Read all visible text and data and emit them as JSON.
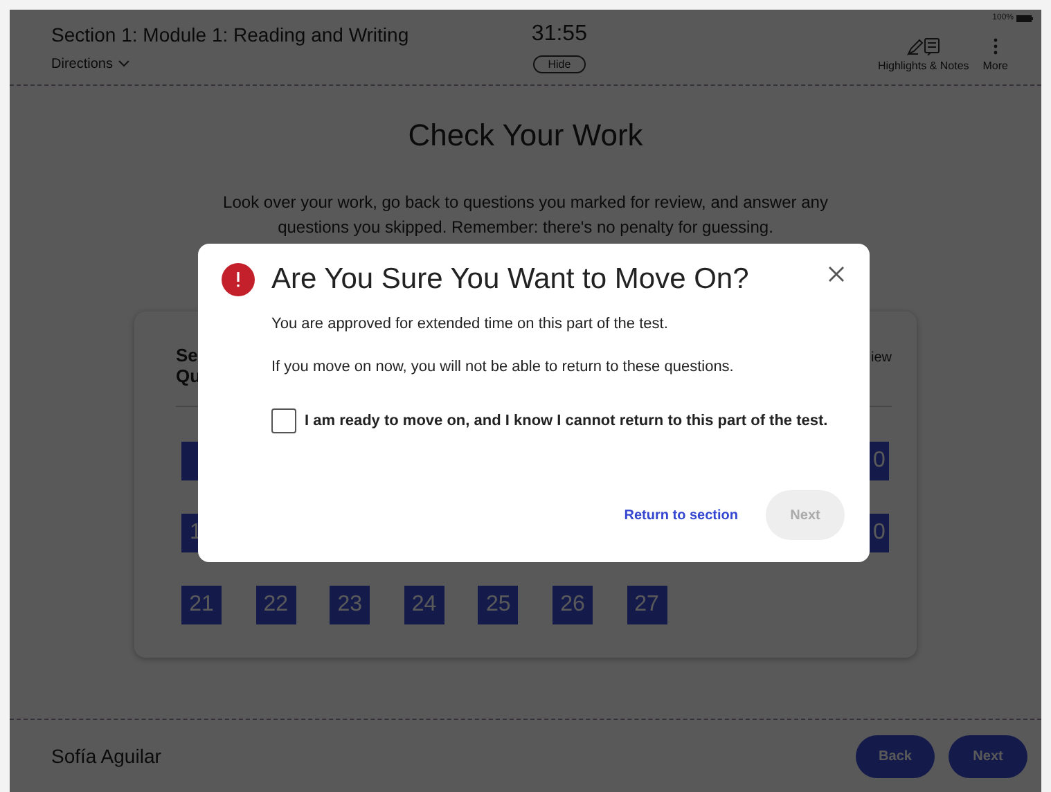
{
  "status": {
    "battery": "100%"
  },
  "header": {
    "title": "Section 1: Module 1: Reading and Writing",
    "directions": "Directions",
    "timer": "31:55",
    "hide_button": "Hide",
    "tools": [
      {
        "label": "Highlights & Notes",
        "kind": "highlights"
      },
      {
        "label": "More",
        "kind": "more"
      }
    ]
  },
  "page": {
    "title": "Check Your Work",
    "instructions": "Look over your work, go back to questions you marked for review, and answer any questions you skipped. Remember: there's no penalty for guessing.",
    "card": {
      "heading_lines": [
        "Se",
        "Qu"
      ],
      "legend": "iew",
      "rows": [
        {
          "cells": [
            {
              "label": "0",
              "kind": "last"
            }
          ]
        },
        {
          "cells": [
            {
              "label": "1",
              "kind": "first"
            },
            {
              "label": "0",
              "kind": "last"
            }
          ]
        },
        {
          "cells": [
            {
              "label": "21",
              "kind": "full"
            },
            {
              "label": "22",
              "kind": "full"
            },
            {
              "label": "23",
              "kind": "full"
            },
            {
              "label": "24",
              "kind": "full"
            },
            {
              "label": "25",
              "kind": "full"
            },
            {
              "label": "26",
              "kind": "full"
            },
            {
              "label": "27",
              "kind": "full"
            }
          ]
        }
      ]
    }
  },
  "footer": {
    "student": "Sofía Aguilar",
    "buttons": [
      {
        "label": "Back"
      },
      {
        "label": "Next"
      }
    ]
  },
  "dialog": {
    "title": "Are You Sure You Want to Move On?",
    "messages": [
      "You are approved for extended time on this part of the test.",
      "If you move on now, you will not be able to return to these questions."
    ],
    "confirm": {
      "label": "I am ready to move on, and I know I cannot return to this part of the test.",
      "checked": false
    },
    "link": "Return to section",
    "next": {
      "label": "Next",
      "disabled": true
    }
  }
}
